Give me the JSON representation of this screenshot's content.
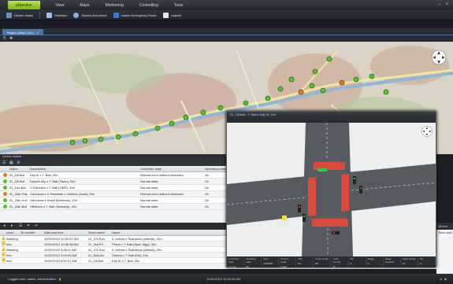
{
  "menu": {
    "app_name": "eDjective",
    "items": [
      "View",
      "Maps",
      "Monitoring",
      "Controlling",
      "Tools"
    ]
  },
  "toolbar": {
    "device_status": "Device status",
    "selection": "Selection",
    "search_select": "Search and select",
    "emergency_route": "Insane Emergency Route",
    "legend": "Legend"
  },
  "map_tab": {
    "label": "Region (Mlýn, Zlín)"
  },
  "device_panel": {
    "title": "Device status",
    "columns": [
      "Name",
      "Description",
      "Controller state",
      "Operating state"
    ],
    "rows": [
      {
        "status": "orange",
        "name": "ZL_Dil-Bat",
        "desc": "Díly III x T. Bati, Zlín",
        "state": "Internal error without shutdown",
        "op": "On"
      },
      {
        "status": "green",
        "name": "ZL_Dil-Bat",
        "desc": "Dlouhé díly x T. Bati (Tamu), Zlín",
        "state": "Normal state",
        "op": "On"
      },
      {
        "status": "green",
        "name": "ZL_Dre-Bat",
        "desc": "U Dřevnice x T. Bati (OMV), Zlín",
        "state": "Normal state",
        "op": "On"
      },
      {
        "status": "orange",
        "name": "ZL_Gah-Pas",
        "desc": "Gahurova x K Pasekám x Vižecha (Avail), Zlín",
        "state": "Internal error without shutdown",
        "op": "On"
      },
      {
        "status": "green",
        "name": "ZL_Gah-Vrsl",
        "desc": "Gahurova x Vrsek (třešňová), Zlín",
        "state": "Normal state",
        "op": "On"
      },
      {
        "status": "green",
        "name": "ZL_Gah-Bat",
        "desc": "Hřbitovní x T. Bati (Samohýl), Zlín",
        "state": "Normal state",
        "op": "On"
      }
    ]
  },
  "event_log": {
    "columns": [
      "Level",
      "To confirm",
      "Date and time",
      "Short name",
      "Name"
    ],
    "rows": [
      {
        "level": "Warning",
        "kind": "warning",
        "confirm": "",
        "date": "10/31/2012 10:59:57 AM",
        "short": "ZL_3.5-Sva",
        "name": "3. května x Švándova (cihelna), Zlín"
      },
      {
        "level": "Info",
        "kind": "info",
        "confirm": "",
        "date": "10/31/2012 10:48:38 AM",
        "short": "ZL_Sla-Pri",
        "name": "Přímá x T. Bati (Spar, Algy), Zlín"
      },
      {
        "level": "Warning",
        "kind": "warning",
        "confirm": "",
        "date": "10/31/2012 9:46:11 AM",
        "short": "ZL_3.5-Sva",
        "name": "3. května x Švándova (cihelna), Zlín"
      },
      {
        "level": "Info",
        "kind": "info",
        "confirm": "",
        "date": "10/31/2012 9:04:06 AM",
        "short": "ZL_Bat-Dlo",
        "name": "Dlouhá x T. Bati (KB), Zlín"
      },
      {
        "level": "Info",
        "kind": "info",
        "confirm": "",
        "date": "10/31/2012 8:51:07 AM",
        "short": "ZL_Dil-Bat",
        "name": "Díly III x T. Bati, Zlín"
      }
    ],
    "right_header": "All eve",
    "right_col": "Time conf"
  },
  "popup": {
    "title": "ZL_Dil-Bat - T. Bati x Díly III, Zlín",
    "columns": [
      "Controller state",
      "Operating state",
      "Time",
      "Control mode",
      "Plan",
      "Cycle length",
      "Cycle second",
      "TR",
      "Stage",
      "Stage transition",
      "Stage length",
      "SG"
    ],
    "values": [
      "Normal",
      "On",
      "10:59:06",
      "Local actuated",
      "P1",
      "90",
      "41",
      "0",
      "2",
      "",
      "19",
      "2"
    ]
  },
  "status": {
    "user": "Logged user: admin, Administrator",
    "time": "10/31/2012 11:00:40 AM"
  },
  "colors": {
    "accent": "#8cc63f",
    "status_orange": "#e07a22",
    "status_green": "#5cb82e"
  }
}
